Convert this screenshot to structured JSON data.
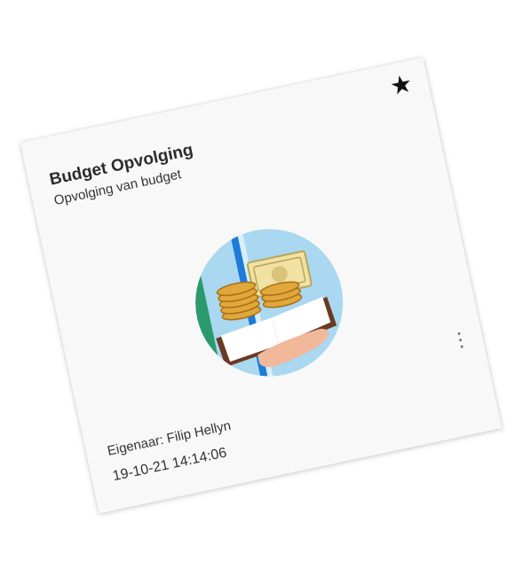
{
  "card": {
    "title": "Budget Opvolging",
    "subtitle": "Opvolging van budget",
    "owner": "Eigenaar: Filip Hellyn",
    "date": "19-10-21 14:14:06",
    "favorite_icon": "star-icon",
    "menu_icon": "more-vertical-icon",
    "illustration": "budget-book-money-icon"
  },
  "colors": {
    "circle_bg": "#a9d8f0",
    "book_cover": "#6b3a22",
    "coin": "#e0a73a",
    "banknote": "#f1e2a3",
    "accent_green": "#2a9a6c",
    "accent_blue": "#1e7bd8"
  }
}
